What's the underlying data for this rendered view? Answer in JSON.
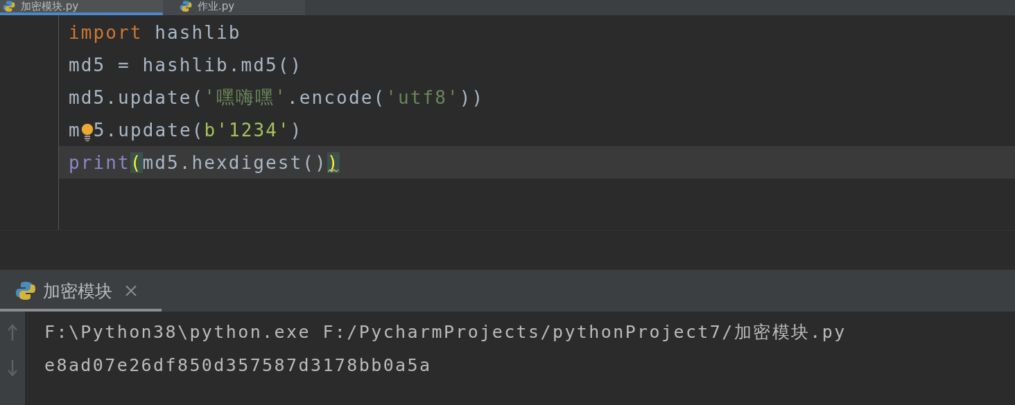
{
  "editor_tabs": [
    {
      "label": "加密模块.py",
      "selected": true
    },
    {
      "label": "作业.py",
      "selected": false
    }
  ],
  "code_lines": [
    {
      "current": false,
      "tokens": [
        {
          "kind": "keyword",
          "text": "import"
        },
        {
          "kind": "plain",
          "text": " hashlib"
        }
      ]
    },
    {
      "current": false,
      "tokens": [
        {
          "kind": "plain",
          "text": "md5 = hashlib.md5()"
        }
      ]
    },
    {
      "current": false,
      "tokens": [
        {
          "kind": "plain",
          "text": "md5.update("
        },
        {
          "kind": "string",
          "text": "'嘿嗨嘿'"
        },
        {
          "kind": "plain",
          "text": ".encode("
        },
        {
          "kind": "string",
          "text": "'utf8'"
        },
        {
          "kind": "plain",
          "text": "))"
        }
      ]
    },
    {
      "current": false,
      "tokens": [
        {
          "kind": "plain",
          "text": "m"
        },
        {
          "kind": "bulb"
        },
        {
          "kind": "plain",
          "text": "5.update("
        },
        {
          "kind": "bytes",
          "text": "b'1234'"
        },
        {
          "kind": "plain",
          "text": ")"
        }
      ]
    },
    {
      "current": true,
      "tokens": [
        {
          "kind": "builtin",
          "text": "print"
        },
        {
          "kind": "match",
          "text": "("
        },
        {
          "kind": "plain",
          "text": "md5.hexdigest()"
        },
        {
          "kind": "match",
          "text": ")",
          "warning": true
        }
      ]
    }
  ],
  "run_panel": {
    "tab": {
      "label": "加密模块",
      "selected": true
    },
    "output": [
      "F:\\Python38\\python.exe F:/PycharmProjects/pythonProject7/加密模块.py",
      "e8ad07e26df850d357587d3178bb0a5a"
    ]
  }
}
